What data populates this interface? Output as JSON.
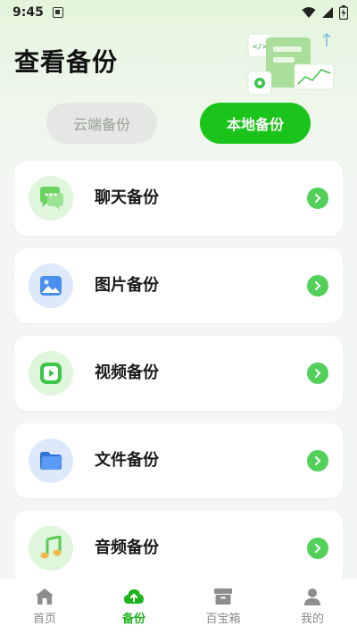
{
  "status_bar": {
    "time": "9:45"
  },
  "header": {
    "title": "查看备份"
  },
  "tabs": [
    {
      "label": "云端备份",
      "active": false
    },
    {
      "label": "本地备份",
      "active": true
    }
  ],
  "backup_items": [
    {
      "label": "聊天备份",
      "icon": "chat-icon"
    },
    {
      "label": "图片备份",
      "icon": "image-icon"
    },
    {
      "label": "视频备份",
      "icon": "video-icon"
    },
    {
      "label": "文件备份",
      "icon": "folder-icon"
    },
    {
      "label": "音频备份",
      "icon": "music-icon"
    }
  ],
  "bottom_nav": [
    {
      "label": "首页",
      "icon": "home-icon",
      "active": false
    },
    {
      "label": "备份",
      "icon": "cloud-upload-icon",
      "active": true
    },
    {
      "label": "百宝箱",
      "icon": "box-icon",
      "active": false
    },
    {
      "label": "我的",
      "icon": "user-icon",
      "active": false
    }
  ],
  "colors": {
    "accent": "#1bc41b",
    "arrow": "#52d05a",
    "background": "#f3f6f2"
  }
}
